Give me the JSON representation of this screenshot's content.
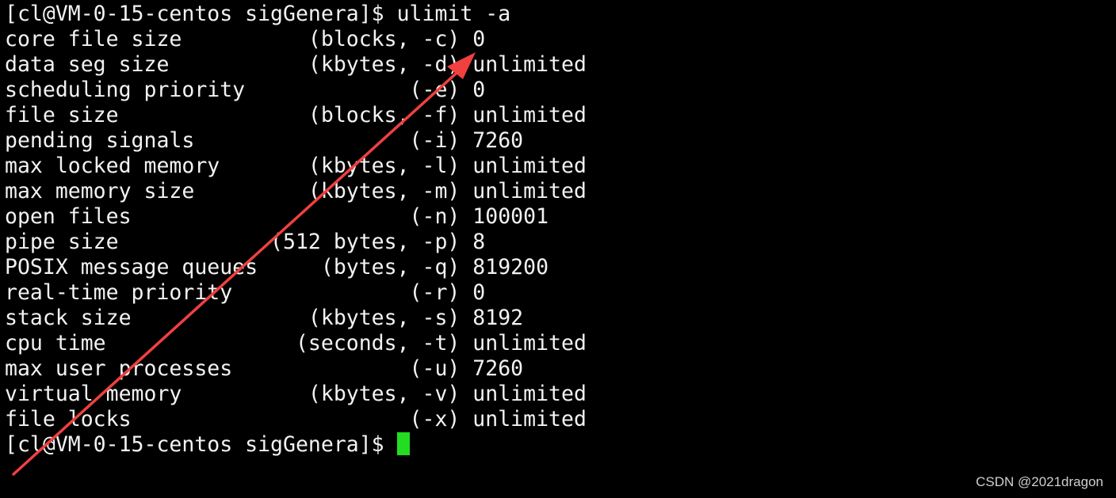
{
  "terminal": {
    "lines": [
      "[cl@VM-0-15-centos sigGenera]$ ulimit -a",
      "core file size          (blocks, -c) 0",
      "data seg size           (kbytes, -d) unlimited",
      "scheduling priority             (-e) 0",
      "file size               (blocks, -f) unlimited",
      "pending signals                 (-i) 7260",
      "max locked memory       (kbytes, -l) unlimited",
      "max memory size         (kbytes, -m) unlimited",
      "open files                      (-n) 100001",
      "pipe size            (512 bytes, -p) 8",
      "POSIX message queues     (bytes, -q) 819200",
      "real-time priority              (-r) 0",
      "stack size              (kbytes, -s) 8192",
      "cpu time               (seconds, -t) unlimited",
      "max user processes              (-u) 7260",
      "virtual memory          (kbytes, -v) unlimited",
      "file locks                      (-x) unlimited"
    ],
    "prompt": "[cl@VM-0-15-centos sigGenera]$ ",
    "cursor_color": "#22dd22",
    "text_color": "#f2f2f2",
    "background_color": "#000000"
  },
  "annotation": {
    "arrow_color": "#f04040",
    "icon": "red-arrow-annotation"
  },
  "watermark": "CSDN @2021dragon"
}
